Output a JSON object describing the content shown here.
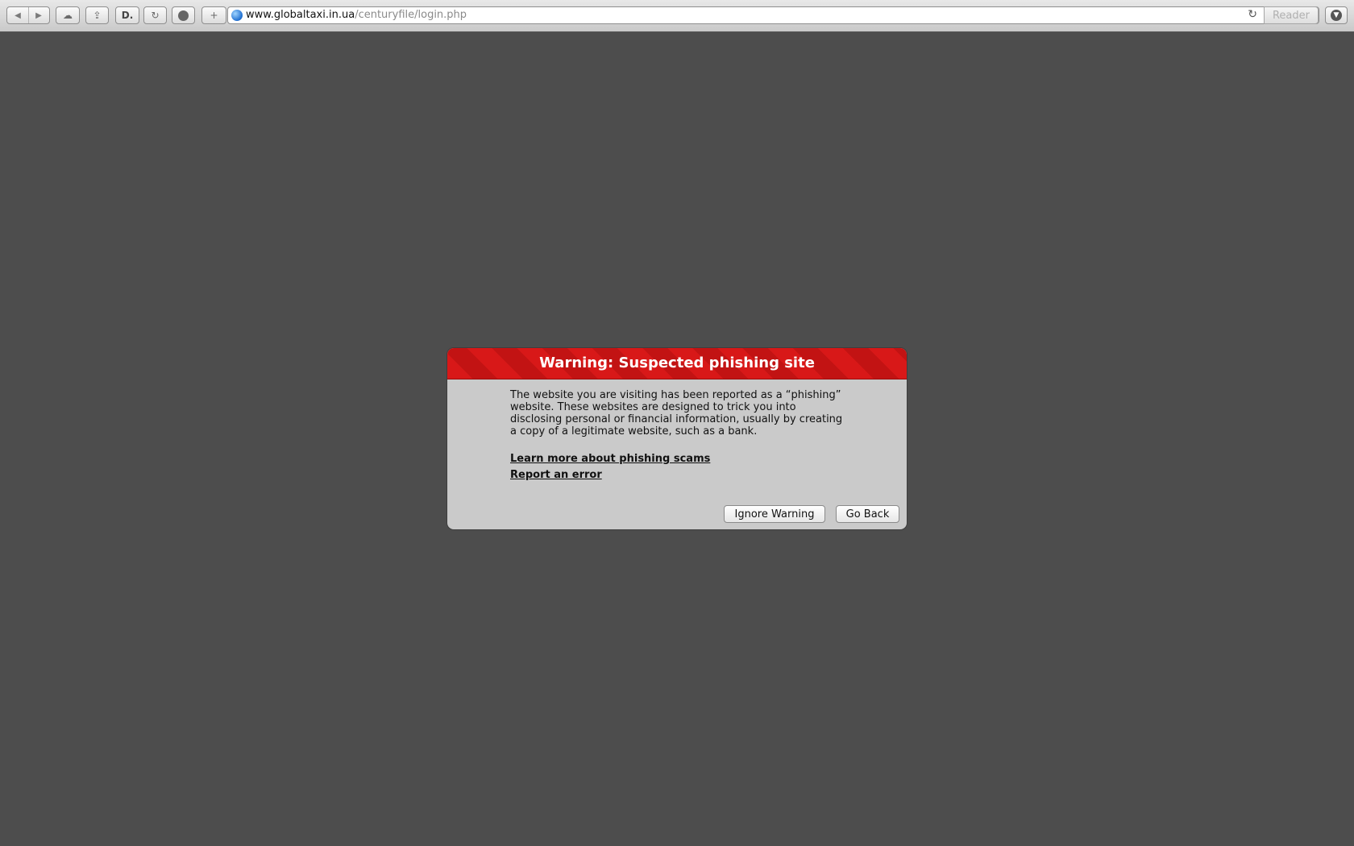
{
  "browser": {
    "url_host": "www.globaltaxi.in.ua",
    "url_path": "/centuryfile/login.php",
    "reader_label": "Reader",
    "toolbar_icons": [
      "back-icon",
      "forward-icon",
      "icloud-icon",
      "share-icon",
      "readability-icon",
      "reload-icon",
      "ad-block-icon",
      "new-tab-icon",
      "globe-icon",
      "refresh-icon",
      "download-icon"
    ]
  },
  "dialog": {
    "title": "Warning: Suspected phishing site",
    "message": "The website you are visiting has been reported as a “phishing” website. These websites are designed to trick you into disclosing personal or financial information, usually by creating a copy of a legitimate website, such as a bank.",
    "learn_more_link": "Learn more about phishing scams",
    "report_link": "Report an error",
    "ignore_button": "Ignore Warning",
    "go_back_button": "Go Back",
    "header_color": "#d81818"
  }
}
